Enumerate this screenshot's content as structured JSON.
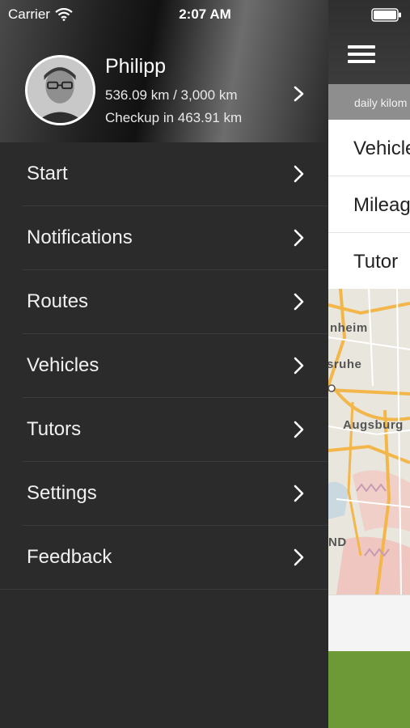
{
  "status_bar": {
    "carrier": "Carrier",
    "time": "2:07 AM"
  },
  "profile": {
    "name": "Philipp",
    "distance": "536.09 km / 3,000 km",
    "checkup": "Checkup in 463.91 km"
  },
  "menu": {
    "items": [
      {
        "label": "Start"
      },
      {
        "label": "Notifications"
      },
      {
        "label": "Routes"
      },
      {
        "label": "Vehicles"
      },
      {
        "label": "Tutors"
      },
      {
        "label": "Settings"
      },
      {
        "label": "Feedback"
      }
    ]
  },
  "content": {
    "subheader": "daily kilom",
    "list": [
      {
        "label": "Vehicle"
      },
      {
        "label": "Mileag"
      },
      {
        "label": "Tutor"
      }
    ],
    "map_labels": {
      "city1": "nheim",
      "city2": "sruhe",
      "city3": "Augsburg",
      "region": "ND"
    }
  },
  "icons": {
    "wifi": "wifi-icon",
    "battery": "battery-icon",
    "hamburger": "hamburger-menu-icon",
    "chevron": "chevron-right-icon"
  },
  "colors": {
    "menu_background": "#2b2b2b",
    "footer_green": "#6d9a36",
    "subheader_gray": "#8e8e8e"
  }
}
